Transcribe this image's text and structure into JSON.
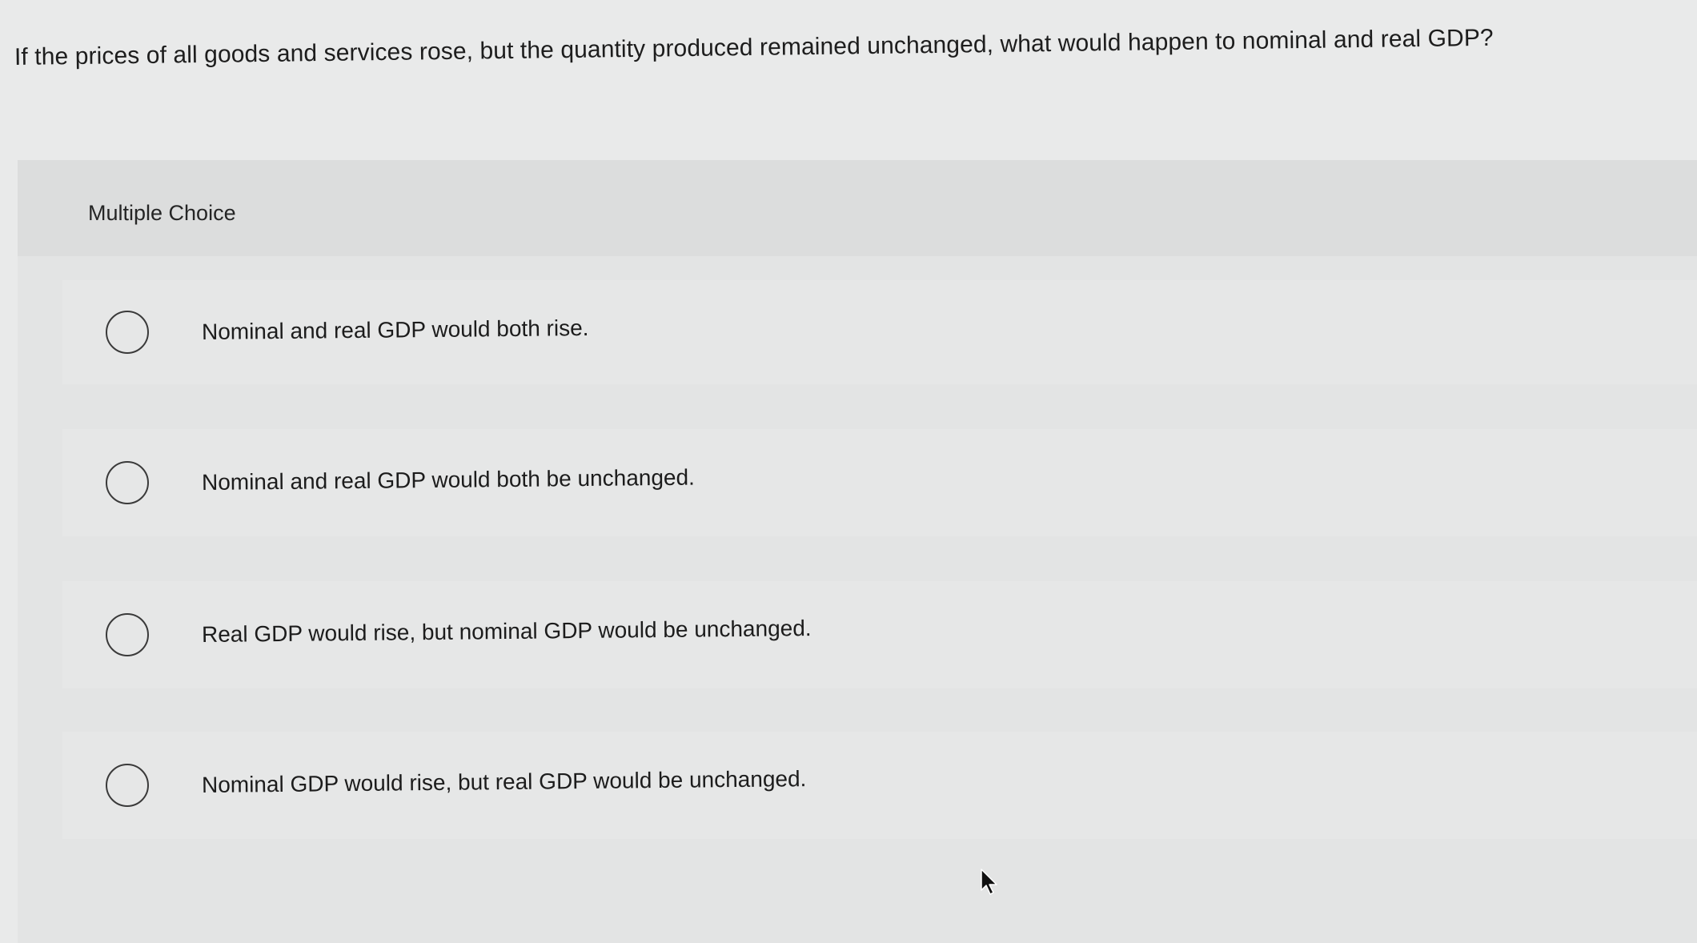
{
  "question": {
    "text": "If the prices of all goods and services rose, but the quantity produced remained unchanged, what would happen to nominal and real GDP?"
  },
  "multiple_choice": {
    "header_label": "Multiple Choice",
    "options": [
      {
        "label": "Nominal and real GDP would both rise.",
        "selected": false
      },
      {
        "label": "Nominal and real GDP would both be unchanged.",
        "selected": false
      },
      {
        "label": "Real GDP would rise, but nominal GDP would be unchanged.",
        "selected": false
      },
      {
        "label": "Nominal GDP would rise, but real GDP would be unchanged.",
        "selected": false
      }
    ]
  },
  "icons": {
    "radio": "radio-circle-icon",
    "cursor": "mouse-pointer-icon"
  },
  "colors": {
    "background": "#e9eaea",
    "panel": "#e3e4e4",
    "text": "#1d1d1d",
    "radio_border": "#3a3a3a"
  }
}
